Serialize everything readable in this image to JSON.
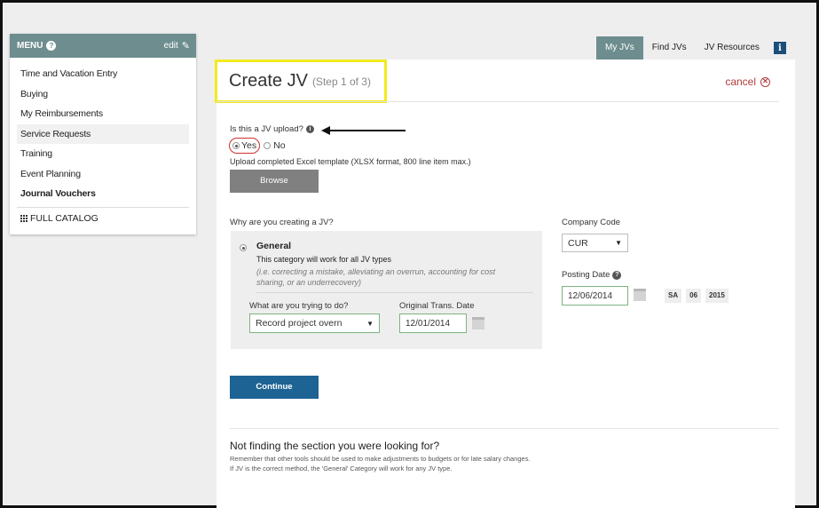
{
  "sidebar": {
    "menu_label": "MENU",
    "edit_label": "edit",
    "items": [
      {
        "label": "Time and Vacation Entry"
      },
      {
        "label": "Buying"
      },
      {
        "label": "My Reimbursements"
      },
      {
        "label": "Service Requests"
      },
      {
        "label": "Training"
      },
      {
        "label": "Event Planning"
      },
      {
        "label": "Journal Vouchers"
      }
    ],
    "full_catalog": "FULL CATALOG"
  },
  "tabs": [
    {
      "label": "My JVs"
    },
    {
      "label": "Find JVs"
    },
    {
      "label": "JV Resources"
    }
  ],
  "page": {
    "title": "Create JV",
    "step": "(Step 1 of 3)",
    "cancel_label": "cancel"
  },
  "upload": {
    "question": "Is this a JV upload?",
    "yes_label": "Yes",
    "no_label": "No",
    "selected": "Yes",
    "note": "Upload completed Excel template (XLSX format, 800 line item max.)",
    "browse_label": "Browse"
  },
  "reason": {
    "question": "Why are you creating a JV?",
    "general_title": "General",
    "general_sub": "This category will work for all JV types",
    "general_desc": "(i.e. correcting a mistake, alleviating an overrun, accounting for cost sharing, or an underrecovery)",
    "what_label": "What are you trying to do?",
    "what_value": "Record project overn",
    "orig_date_label": "Original Trans. Date",
    "orig_date_value": "12/01/2014"
  },
  "company": {
    "label": "Company Code",
    "value": "CUR"
  },
  "posting": {
    "label": "Posting Date",
    "value": "12/06/2014",
    "period": [
      "SA",
      "06",
      "2015"
    ]
  },
  "continue_label": "Continue",
  "not_finding": {
    "title": "Not finding the section you were looking for?",
    "line1": "Remember that other tools should be used to make adjustments to budgets or for late salary changes.",
    "line2": "If JV is the correct method, the 'General' Category will work for any JV type."
  },
  "colors": {
    "header_teal": "#6e8d8f",
    "primary_blue": "#1d6394",
    "highlight_yellow": "#f2ea1e",
    "cancel_red": "#b23c3c",
    "field_green": "#7fb37f"
  }
}
